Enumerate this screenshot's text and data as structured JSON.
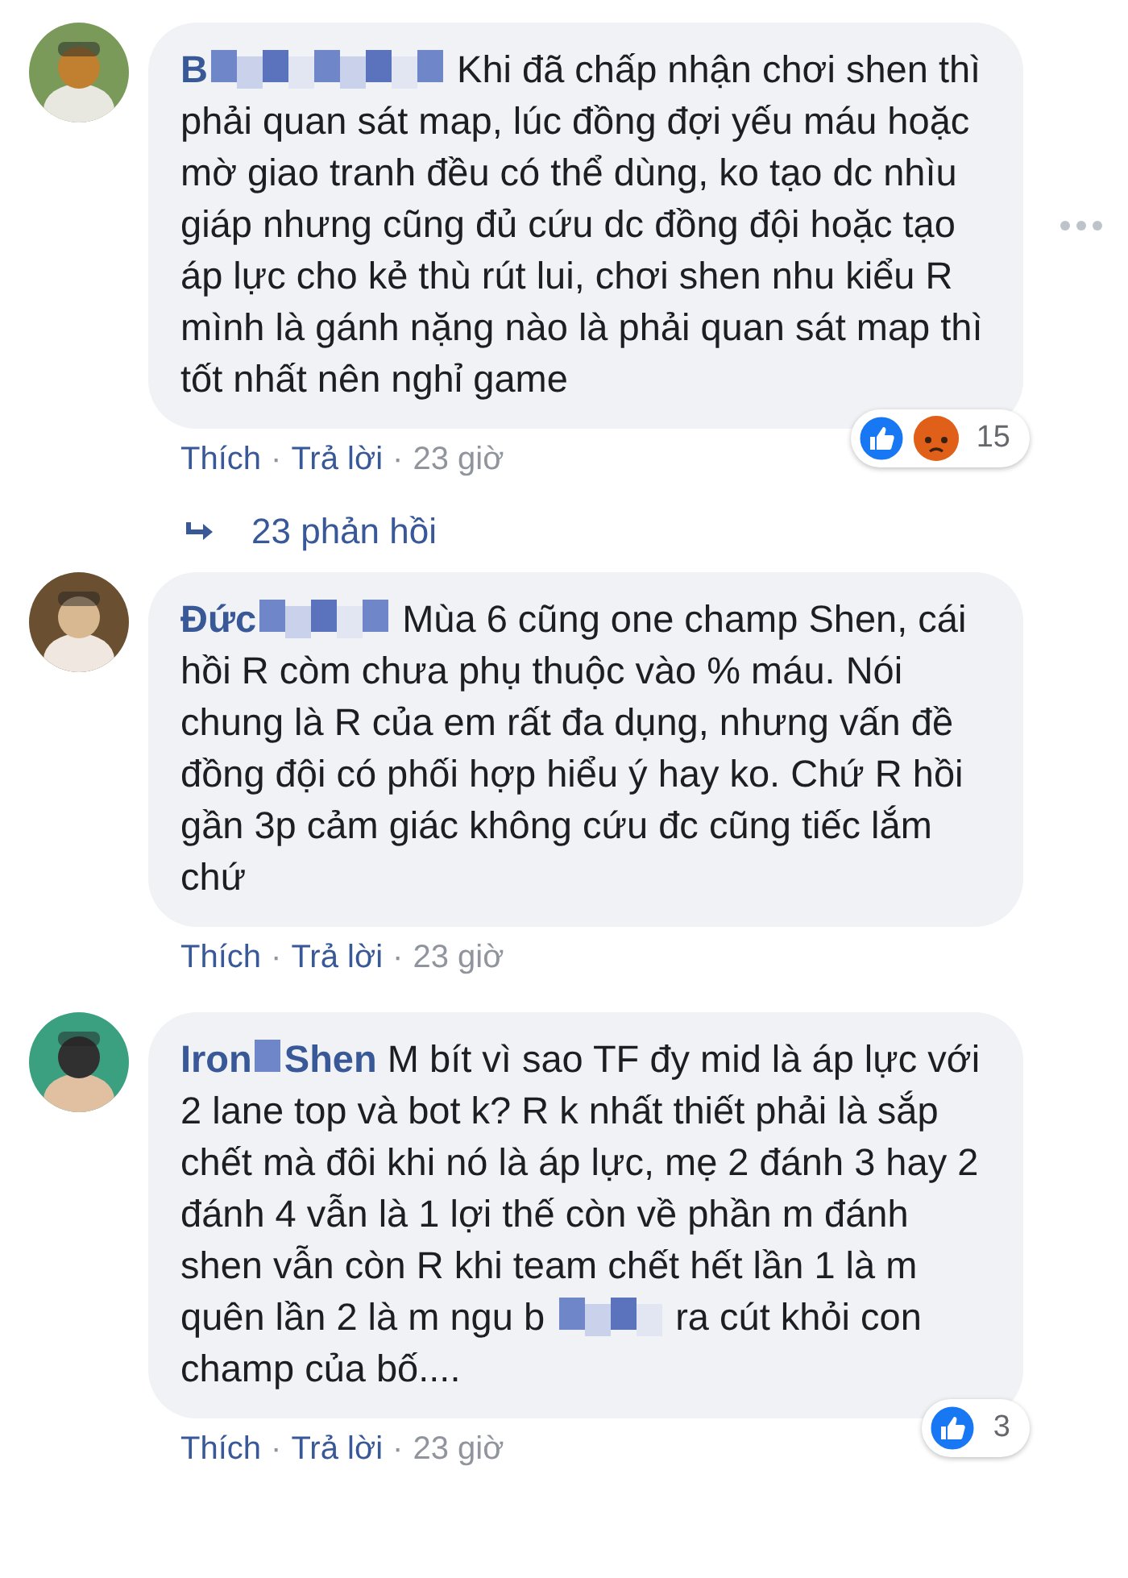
{
  "comments": [
    {
      "name": "B",
      "body": [
        {
          "kind": "text",
          "text": "Khi đã chấp nhận chơi shen thì phải quan sát map, lúc đồng đợi yếu máu hoặc mờ giao tranh đều có thể dùng, ko tạo dc nhìu giáp nhưng cũng đủ cứu dc đồng đội hoặc tạo áp lực cho kẻ thù rút lui, chơi shen nhu kiểu R mình là gánh nặng nào là phải quan sát map thì tốt nhất nên nghỉ game"
        }
      ],
      "actions": {
        "like": "Thích",
        "separator_1": "·",
        "reply": "Trả lời",
        "separator_2": "·",
        "time": "23 giờ"
      },
      "reactions": {
        "icons": [
          {
            "kind": "like"
          },
          {
            "kind": "angry"
          }
        ],
        "count": "15"
      },
      "more_menu": true,
      "replies": "23 phản hồi"
    },
    {
      "name": "Đức",
      "body": [
        {
          "kind": "text",
          "text": "Mùa 6 cũng one champ Shen, cái hồi R còm chưa phụ thuộc vào % máu. Nói chung là R của em rất đa dụng, nhưng vấn đề đồng đội có phối hợp hiểu ý hay ko. Chứ R hồi gần 3p cảm giác không cứu đc cũng tiếc lắm chứ"
        }
      ],
      "actions": {
        "like": "Thích",
        "separator_1": "·",
        "reply": "Trả lời",
        "separator_2": "·",
        "time": "23 giờ"
      },
      "more_menu": false
    },
    {
      "name": "Iron",
      "name_rest": "Shen",
      "body": [
        {
          "kind": "text",
          "text": "M bít vì sao TF đy mid là áp lực với 2 lane top và bot k? R k nhất thiết phải là sắp chết mà đôi khi nó là áp lực, mẹ 2 đánh 3 hay 2 đánh 4 vẫn là 1 lợi thế còn về phần m đánh shen vẫn còn R khi team chết hết lần 1 là m quên lần 2 là m ngu b"
        },
        {
          "kind": "censor"
        },
        {
          "kind": "text",
          "text": "ra cút khỏi con champ của bố...."
        }
      ],
      "actions": {
        "like": "Thích",
        "separator_1": "·",
        "reply": "Trả lời",
        "separator_2": "·",
        "time": "23 giờ"
      },
      "reactions": {
        "icons": [
          {
            "kind": "like"
          }
        ],
        "count": "3"
      },
      "more_menu": false
    }
  ]
}
